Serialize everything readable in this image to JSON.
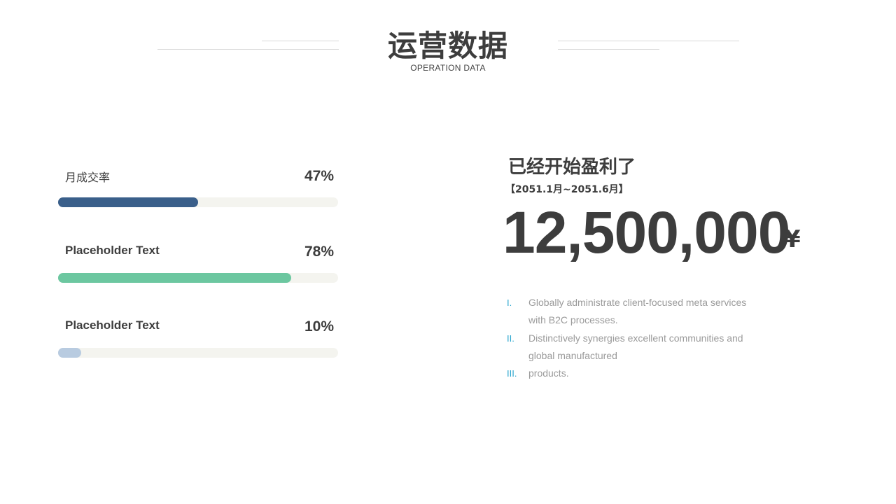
{
  "header": {
    "title": "运营数据",
    "subtitle": "OPERATION DATA"
  },
  "progress": {
    "items": [
      {
        "label": "月成交率",
        "percent_text": "47%",
        "value": 0.5,
        "color": "#3a5f8a"
      },
      {
        "label": "Placeholder Text",
        "percent_text": "78%",
        "value": 0.833,
        "color": "#6cc7a0"
      },
      {
        "label": "Placeholder Text",
        "percent_text": "10%",
        "value": 0.083,
        "color": "#b8cbe0"
      }
    ],
    "track_color": "#f4f4ef"
  },
  "profit": {
    "heading": "已经开始盈利了",
    "period": "【2051.1月~2051.6月】",
    "amount": "12,500,000",
    "currency": "¥"
  },
  "notes": [
    {
      "marker": "I.",
      "text": "Globally administrate client-focused meta services with B2C processes."
    },
    {
      "marker": "II.",
      "text": "Distinctively synergies excellent communities and global manufactured"
    },
    {
      "marker": "III.",
      "text": "products."
    }
  ],
  "colors": {
    "text": "#3d3d3d",
    "muted": "#9a9a9a",
    "accent": "#2aa6cf"
  }
}
